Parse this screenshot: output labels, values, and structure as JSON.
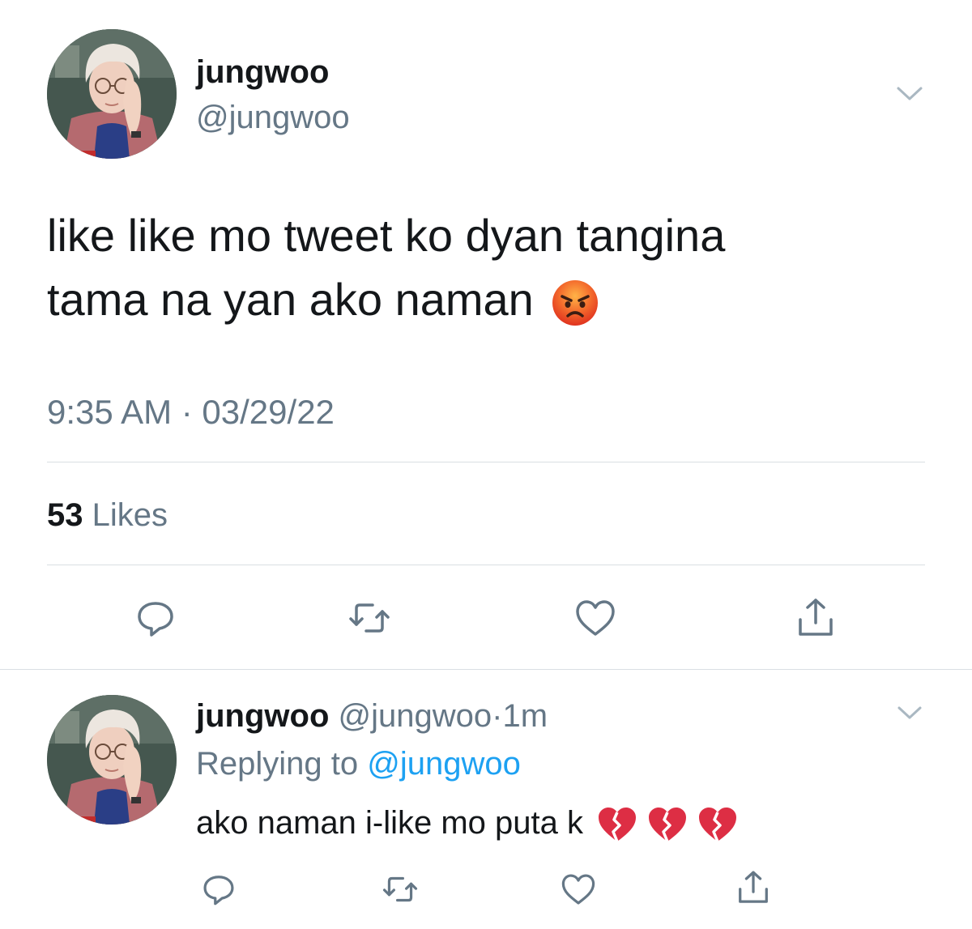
{
  "tweet": {
    "author_name": "jungwoo",
    "author_handle": "@jungwoo",
    "text_lines": [
      "like like mo tweet ko dyan tangina",
      "tama na yan ako naman"
    ],
    "emoji": "angry-face",
    "timestamp": "9:35 AM · 03/29/22",
    "likes_count": "53",
    "likes_label": "Likes",
    "actions": [
      "reply-icon",
      "retweet-icon",
      "like-icon",
      "share-icon"
    ]
  },
  "reply": {
    "author_name": "jungwoo",
    "author_handle": "@jungwoo",
    "dot": "·",
    "time_ago": "1m",
    "replying_label": "Replying to",
    "replying_handle": "@jungwoo",
    "text": "ako naman i-like mo puta k",
    "emojis": [
      "broken-heart",
      "broken-heart",
      "broken-heart"
    ],
    "actions": [
      "reply-icon",
      "retweet-icon",
      "like-icon",
      "share-icon"
    ]
  },
  "colors": {
    "text_primary": "#14171a",
    "text_secondary": "#657786",
    "link": "#1da1f2",
    "divider": "#d9dfe3",
    "icon": "#657786"
  }
}
